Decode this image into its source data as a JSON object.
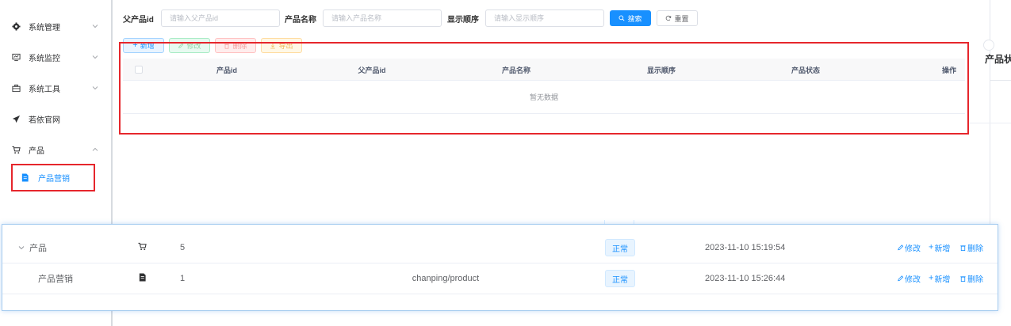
{
  "sidebar": {
    "items": [
      {
        "label": "系统管理",
        "icon": "gear-icon"
      },
      {
        "label": "系统监控",
        "icon": "monitor-icon"
      },
      {
        "label": "系统工具",
        "icon": "toolbox-icon"
      },
      {
        "label": "若依官网",
        "icon": "send-icon"
      },
      {
        "label": "产品",
        "icon": "cart-icon"
      }
    ],
    "submenu": {
      "label": "产品营销",
      "icon": "document-icon"
    }
  },
  "search": {
    "parent_id_label": "父产品id",
    "parent_id_placeholder": "请输入父产品id",
    "name_label": "产品名称",
    "name_placeholder": "请输入产品名称",
    "order_label": "显示顺序",
    "order_placeholder": "请输入显示顺序",
    "search_button": "搜索",
    "reset_button": "重置"
  },
  "toolbar": {
    "add": "新增",
    "edit": "修改",
    "delete": "删除",
    "export": "导出"
  },
  "table": {
    "columns": [
      "产品id",
      "父产品id",
      "产品名称",
      "显示顺序",
      "产品状态",
      "操作"
    ],
    "empty_text": "暂无数据"
  },
  "background": {
    "partial_header": "产品状"
  },
  "overlay": {
    "rows": [
      {
        "name": "产品",
        "icon": "cart-icon",
        "order": "5",
        "path": "",
        "status": "正常",
        "time": "2023-11-10 15:19:54",
        "expandable": true
      },
      {
        "name": "产品营销",
        "icon": "document-icon",
        "order": "1",
        "path": "chanping/product",
        "status": "正常",
        "time": "2023-11-10 15:26:44",
        "expandable": false
      }
    ],
    "actions": {
      "edit": "修改",
      "add": "新增",
      "delete": "删除"
    }
  },
  "colors": {
    "primary": "#1890ff",
    "highlight_red": "#e6262c"
  }
}
